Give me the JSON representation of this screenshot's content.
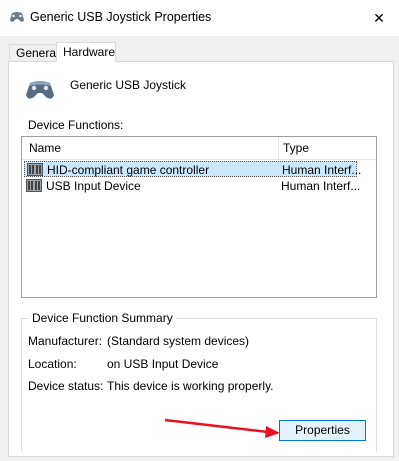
{
  "window": {
    "title": "Generic   USB  Joystick Properties",
    "close_glyph": "✕"
  },
  "tabs": [
    {
      "label": "General",
      "active": false
    },
    {
      "label": "Hardware",
      "active": true
    }
  ],
  "device": {
    "icon": "gamepad-icon",
    "name": "Generic   USB  Joystick"
  },
  "functions": {
    "label": "Device Functions:",
    "columns": [
      "Name",
      "Type"
    ],
    "rows": [
      {
        "icon": "hid-device-icon",
        "name": "HID-compliant game controller",
        "type": "Human Interf...",
        "selected": true
      },
      {
        "icon": "hid-device-icon",
        "name": "USB Input Device",
        "type": "Human Interf...",
        "selected": false
      }
    ]
  },
  "summary": {
    "title": "Device Function Summary",
    "manufacturer_label": "Manufacturer:",
    "manufacturer_value": "(Standard system devices)",
    "location_label": "Location:",
    "location_value": "on USB Input Device",
    "status_label": "Device status:",
    "status_value": "This device is working properly."
  },
  "properties_button": "Properties",
  "annotation": {
    "color": "#e81123",
    "icon": "red-arrow-icon"
  }
}
